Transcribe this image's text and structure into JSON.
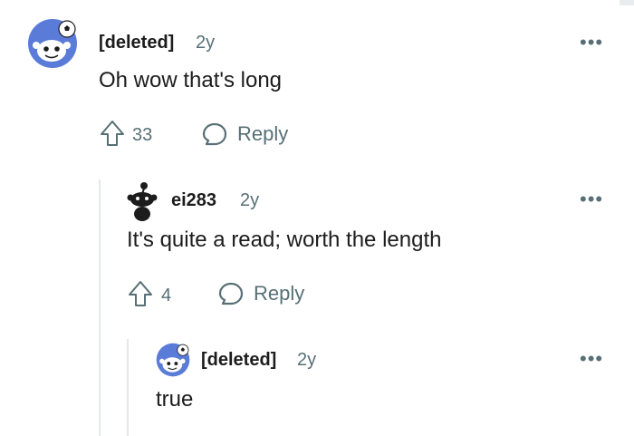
{
  "comments": [
    {
      "username": "[deleted]",
      "age": "2y",
      "body": "Oh wow that's long",
      "upvotes": "33",
      "reply_label": "Reply",
      "more_label": "•••"
    },
    {
      "username": "ei283",
      "age": "2y",
      "body": "It's quite a read; worth the length",
      "upvotes": "4",
      "reply_label": "Reply",
      "more_label": "•••"
    },
    {
      "username": "[deleted]",
      "age": "2y",
      "body": "true",
      "more_label": "•••"
    }
  ],
  "colors": {
    "avatar_bg": "#5a7bd8",
    "text": "#1c1c1c",
    "meta": "#576f76",
    "thread_line": "#e5e7ea"
  },
  "icons": [
    "snoo-avatar-icon",
    "upvote-arrow-icon",
    "comment-bubble-icon",
    "more-options-icon"
  ]
}
